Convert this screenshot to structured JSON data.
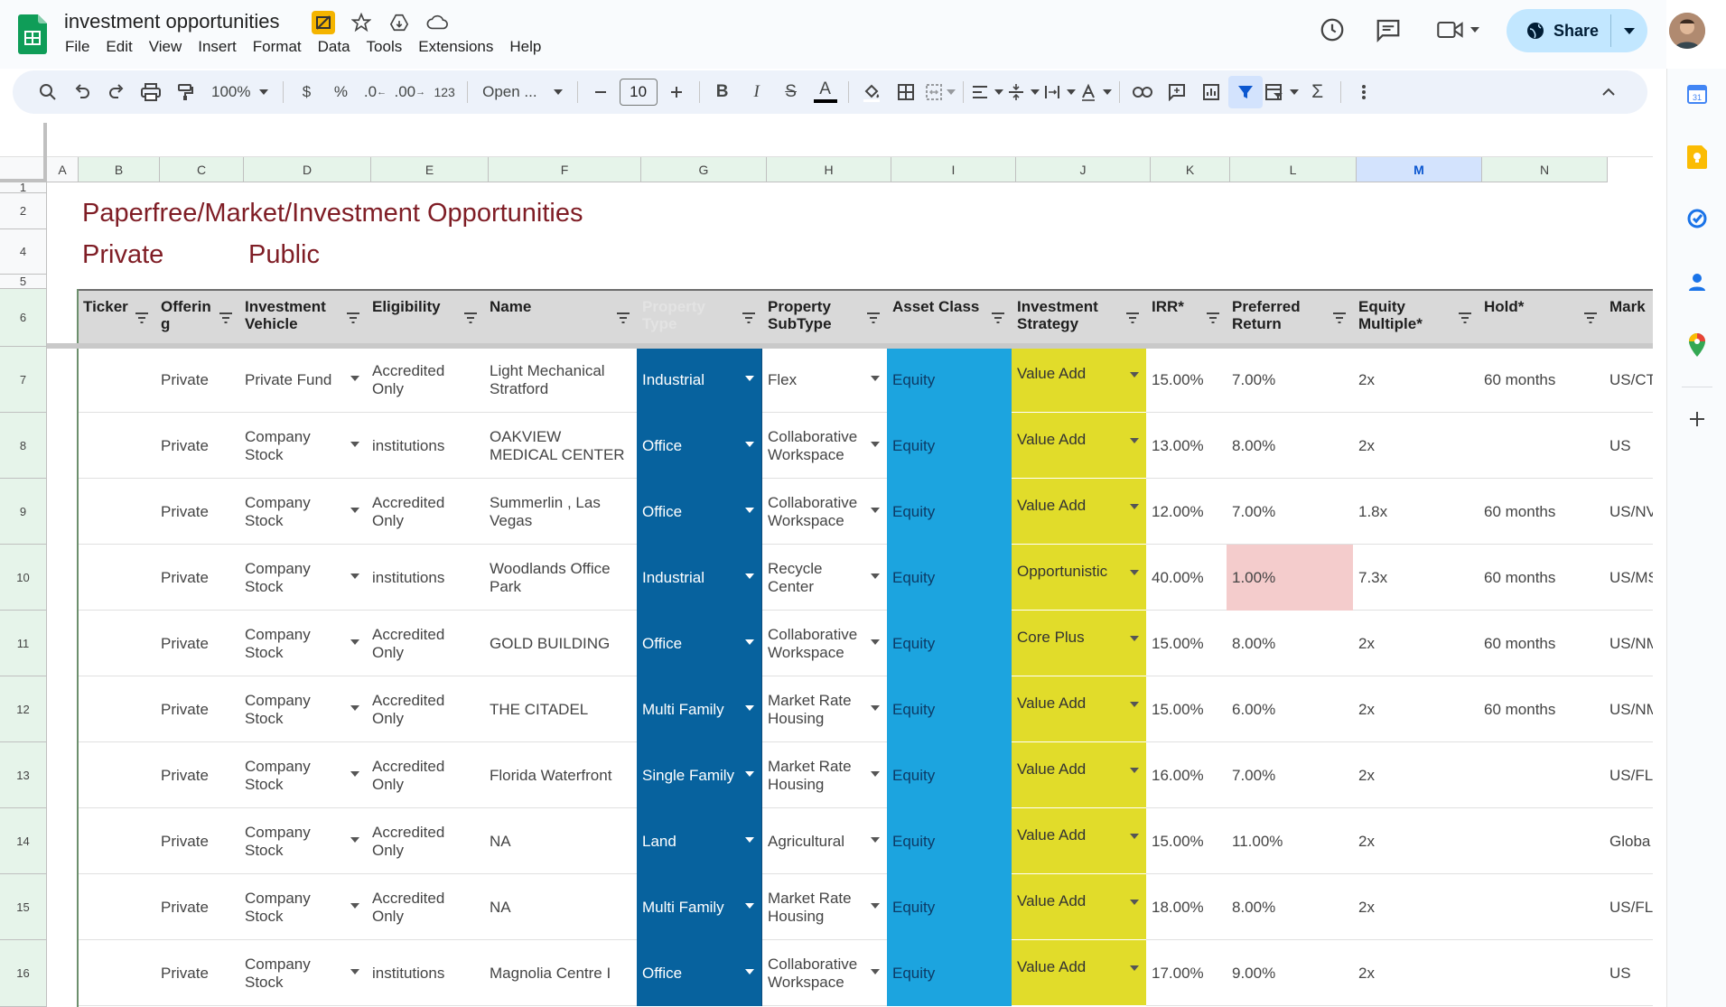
{
  "app": {
    "doc_title": "investment opportunities",
    "menu": [
      "File",
      "Edit",
      "View",
      "Insert",
      "Format",
      "Data",
      "Tools",
      "Extensions",
      "Help"
    ],
    "share_label": "Share"
  },
  "toolbar": {
    "zoom": "100%",
    "currency": "$",
    "percent": "%",
    "dec_decrease": ".0",
    "dec_increase": ".00",
    "number_format": "123",
    "font": "Open ...",
    "font_size": "10",
    "bold": "B",
    "italic": "I",
    "strike": "S",
    "text_color": "A",
    "sum": "Σ"
  },
  "columns": [
    "A",
    "B",
    "C",
    "D",
    "E",
    "F",
    "G",
    "H",
    "I",
    "J",
    "K",
    "L",
    "M",
    "N"
  ],
  "rows_meta": [
    "1",
    "2",
    "4",
    "5",
    "6",
    "7",
    "8",
    "9",
    "10",
    "11",
    "12",
    "13",
    "14",
    "15",
    "16"
  ],
  "sheet": {
    "title": "Paperfree/Market/Investment Opportunities",
    "tab_private": "Private",
    "tab_public": "Public",
    "headers": {
      "ticker": "Ticker",
      "offering": "Offerin g",
      "vehicle": "Investment Vehicle",
      "eligibility": "Eligibility",
      "name": "Name",
      "ptype": "Property Type",
      "psub": "Property SubType",
      "asset": "Asset Class",
      "strategy": "Investment Strategy",
      "irr": "IRR*",
      "pref": "Preferred Return",
      "equity": "Equity Multiple*",
      "hold": "Hold*",
      "market": "Mark"
    },
    "data_rows": [
      {
        "row": "7",
        "offering": "Private",
        "vehicle": "Private Fund",
        "eligibility": "Accredited Only",
        "name": "Light Mechanical Stratford",
        "ptype": "Industrial",
        "psub": "Flex",
        "asset": "Equity",
        "strategy": "Value Add",
        "irr": "15.00%",
        "pref": "7.00%",
        "equity": "2x",
        "hold": "60 months",
        "market": "US/CT"
      },
      {
        "row": "8",
        "offering": "Private",
        "vehicle": "Company Stock",
        "eligibility": "institutions",
        "name": "OAKVIEW MEDICAL CENTER",
        "ptype": "Office",
        "psub": "Collaborative Workspace",
        "asset": "Equity",
        "strategy": "Value Add",
        "irr": "13.00%",
        "pref": "8.00%",
        "equity": "2x",
        "hold": "",
        "market": "US"
      },
      {
        "row": "9",
        "offering": "Private",
        "vehicle": "Company Stock",
        "eligibility": "Accredited Only",
        "name": "Summerlin , Las Vegas",
        "ptype": "Office",
        "psub": "Collaborative Workspace",
        "asset": "Equity",
        "strategy": "Value Add",
        "irr": "12.00%",
        "pref": "7.00%",
        "equity": "1.8x",
        "hold": "60 months",
        "market": "US/NV"
      },
      {
        "row": "10",
        "offering": "Private",
        "vehicle": "Company Stock",
        "eligibility": "institutions",
        "name": "Woodlands Office Park",
        "ptype": "Industrial",
        "psub": "Recycle Center",
        "asset": "Equity",
        "strategy": "Opportunistic",
        "irr": "40.00%",
        "pref": "1.00%",
        "equity": "7.3x",
        "hold": "60 months",
        "market": "US/MS",
        "pref_low": true
      },
      {
        "row": "11",
        "offering": "Private",
        "vehicle": "Company Stock",
        "eligibility": "Accredited Only",
        "name": "GOLD BUILDING",
        "ptype": "Office",
        "psub": "Collaborative Workspace",
        "asset": "Equity",
        "strategy": "Core Plus",
        "irr": "15.00%",
        "pref": "8.00%",
        "equity": "2x",
        "hold": "60 months",
        "market": "US/NM"
      },
      {
        "row": "12",
        "offering": "Private",
        "vehicle": "Company Stock",
        "eligibility": "Accredited Only",
        "name": "THE CITADEL",
        "ptype": "Multi Family",
        "psub": "Market Rate Housing",
        "asset": "Equity",
        "strategy": "Value Add",
        "irr": "15.00%",
        "pref": "6.00%",
        "equity": "2x",
        "hold": "60 months",
        "market": "US/NM"
      },
      {
        "row": "13",
        "offering": "Private",
        "vehicle": "Company Stock",
        "eligibility": "Accredited Only",
        "name": "Florida Waterfront",
        "ptype": "Single Family",
        "psub": "Market Rate Housing",
        "asset": "Equity",
        "strategy": "Value Add",
        "irr": "16.00%",
        "pref": "7.00%",
        "equity": "2x",
        "hold": "",
        "market": "US/FL"
      },
      {
        "row": "14",
        "offering": "Private",
        "vehicle": "Company Stock",
        "eligibility": "Accredited Only",
        "name": "NA",
        "ptype": "Land",
        "psub": "Agricultural",
        "asset": "Equity",
        "strategy": "Value Add",
        "irr": "15.00%",
        "pref": "11.00%",
        "equity": "2x",
        "hold": "",
        "market": "Globa"
      },
      {
        "row": "15",
        "offering": "Private",
        "vehicle": "Company Stock",
        "eligibility": "Accredited Only",
        "name": "NA",
        "ptype": "Multi Family",
        "psub": "Market Rate Housing",
        "asset": "Equity",
        "strategy": "Value Add",
        "irr": "18.00%",
        "pref": "8.00%",
        "equity": "2x",
        "hold": "",
        "market": "US/FL"
      },
      {
        "row": "16",
        "offering": "Private",
        "vehicle": "Company Stock",
        "eligibility": "institutions",
        "name": "Magnolia Centre I",
        "ptype": "Office",
        "psub": "Collaborative Workspace",
        "asset": "Equity",
        "strategy": "Value Add",
        "irr": "17.00%",
        "pref": "9.00%",
        "equity": "2x",
        "hold": "",
        "market": "US"
      }
    ]
  },
  "colors": {
    "title_red": "#7f1d25",
    "ptype_blue": "#07629e",
    "asset_blue": "#1ca4df",
    "strategy_yellow": "#e1dc2a",
    "pref_low_pink": "#f4cccc",
    "share_bg": "#c2e7ff"
  }
}
